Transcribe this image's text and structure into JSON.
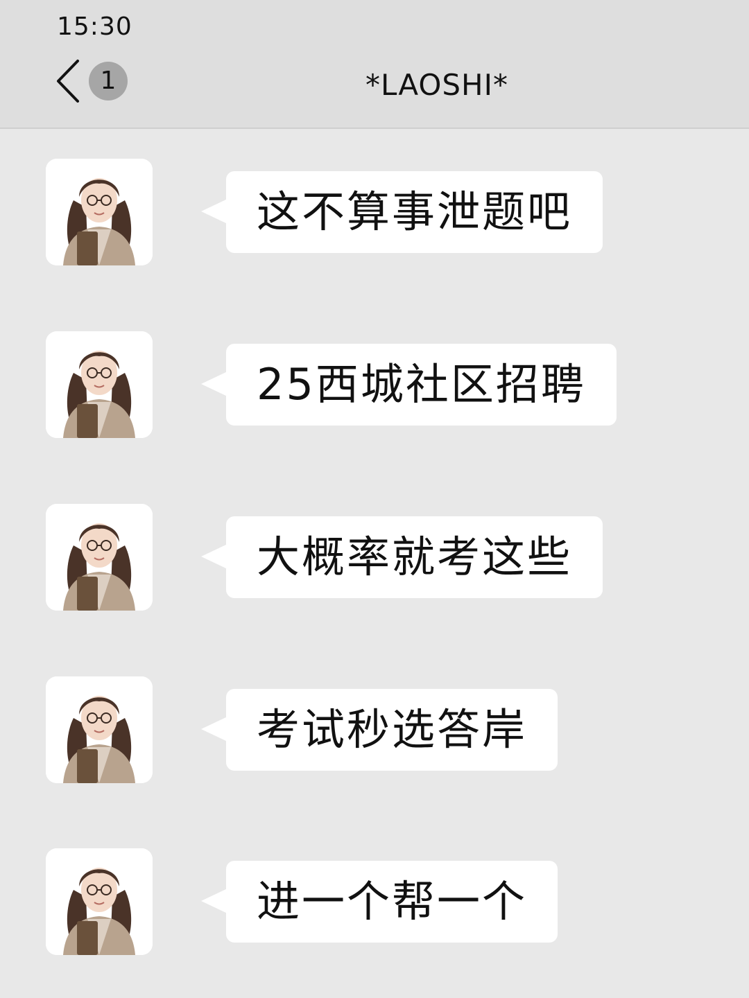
{
  "status_bar": {
    "time": "15:30"
  },
  "header": {
    "back_icon": "chevron-left-icon",
    "unread_count": "1",
    "title": "*LAOSHI*"
  },
  "colors": {
    "background": "#e8e8e8",
    "header_background": "#dedede",
    "bubble": "#ffffff",
    "badge": "#a6a6a6"
  },
  "messages": [
    {
      "sender_avatar": "teacher-avatar",
      "text": "这不算事泄题吧"
    },
    {
      "sender_avatar": "teacher-avatar",
      "text": "25西城社区招聘"
    },
    {
      "sender_avatar": "teacher-avatar",
      "text": "大概率就考这些"
    },
    {
      "sender_avatar": "teacher-avatar",
      "text": "考试秒选答岸"
    },
    {
      "sender_avatar": "teacher-avatar",
      "text": "进一个帮一个"
    }
  ]
}
